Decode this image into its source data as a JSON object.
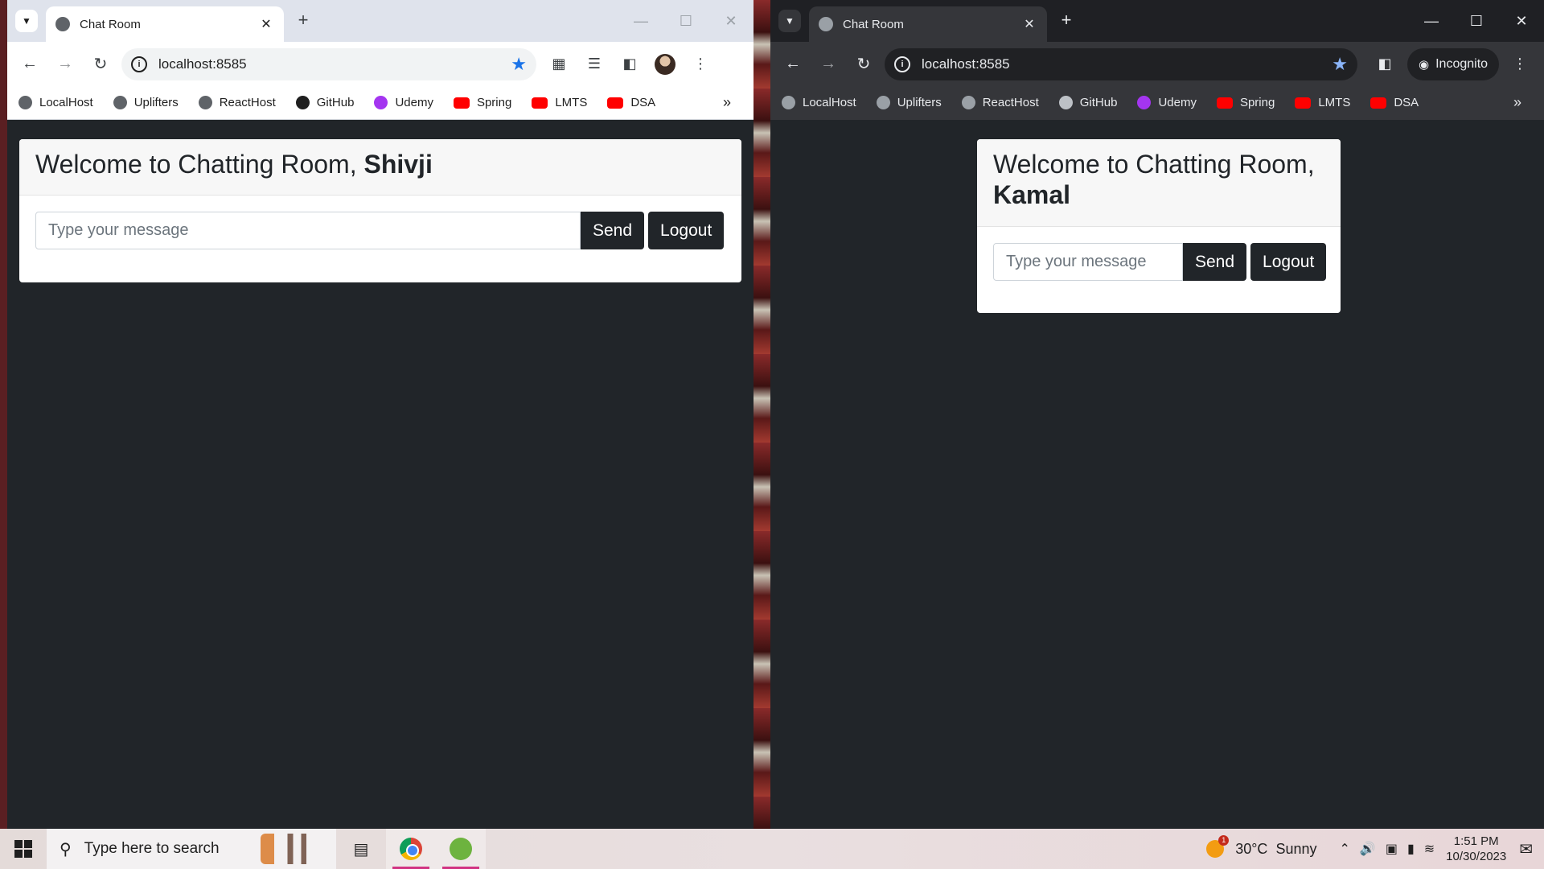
{
  "left_window": {
    "tab_title": "Chat Room",
    "url": "localhost:8585",
    "bookmarks": [
      "LocalHost",
      "Uplifters",
      "ReactHost",
      "GitHub",
      "Udemy",
      "Spring",
      "LMTS",
      "DSA"
    ],
    "welcome_text": "Welcome to Chatting Room, ",
    "username": "Shivji",
    "message_placeholder": "Type your message",
    "send_label": "Send",
    "logout_label": "Logout"
  },
  "right_window": {
    "tab_title": "Chat Room",
    "url": "localhost:8585",
    "incognito_label": "Incognito",
    "bookmarks": [
      "LocalHost",
      "Uplifters",
      "ReactHost",
      "GitHub",
      "Udemy",
      "Spring",
      "LMTS",
      "DSA"
    ],
    "welcome_text": "Welcome to Chatting Room, ",
    "username": "Kamal",
    "message_placeholder": "Type your message",
    "send_label": "Send",
    "logout_label": "Logout"
  },
  "taskbar": {
    "search_placeholder": "Type here to search",
    "weather_temp": "30°C",
    "weather_desc": "Sunny",
    "time": "1:51 PM",
    "date": "10/30/2023",
    "notification_count": "1"
  },
  "icons": {
    "tab_search": "chevron-down-icon",
    "back": "arrow-left-icon",
    "forward": "arrow-right-icon",
    "reload": "reload-icon",
    "bookmark_star": "star-icon",
    "extensions": "puzzle-icon",
    "menu": "kebab-menu-icon"
  },
  "colors": {
    "page_bg": "#212529",
    "button_dark": "#212529",
    "bookmark_star": "#1a73e8"
  }
}
